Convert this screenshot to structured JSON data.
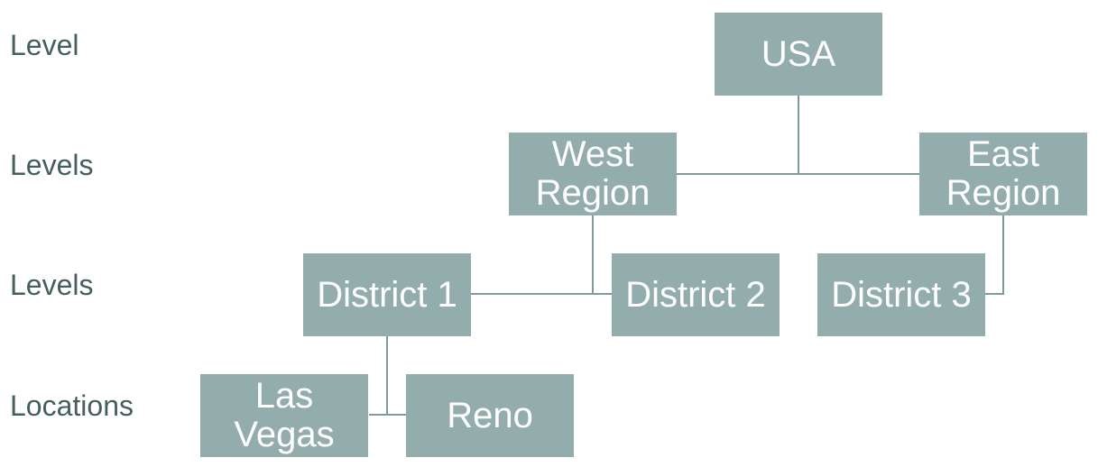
{
  "level_labels": [
    "Level",
    "Levels",
    "Levels",
    "Locations"
  ],
  "nodes": {
    "usa": "USA",
    "west_region": "West\nRegion",
    "east_region": "East\nRegion",
    "district_1": "District 1",
    "district_2": "District 2",
    "district_3": "District 3",
    "las_vegas": "Las\nVegas",
    "reno": "Reno"
  },
  "hierarchy": {
    "USA": [
      "West Region",
      "East Region"
    ],
    "West Region": [
      "District 1",
      "District 2"
    ],
    "East Region": [
      "District 3"
    ],
    "District 1": [
      "Las Vegas",
      "Reno"
    ]
  },
  "colors": {
    "node_fill": "#93adad",
    "node_text": "#ffffff",
    "connector": "#809b9b",
    "label_text": "#455f5f"
  }
}
